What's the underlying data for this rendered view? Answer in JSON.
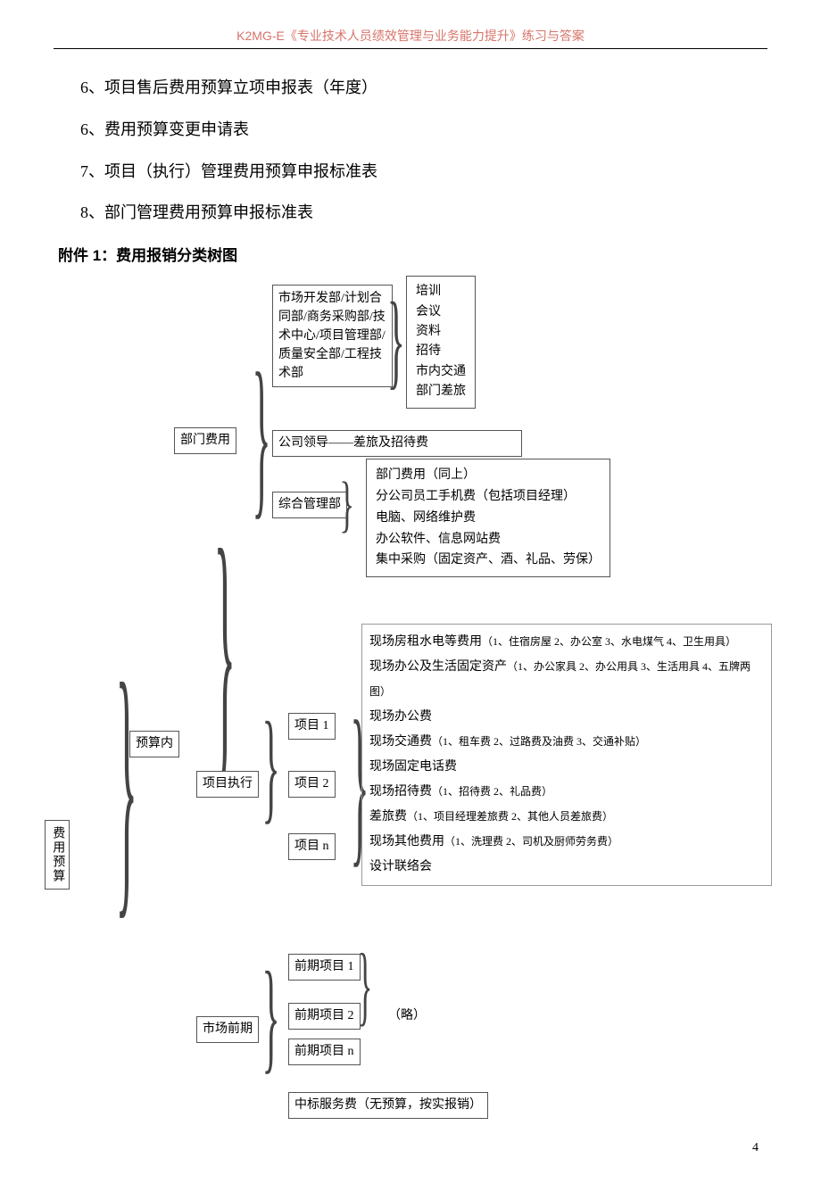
{
  "header": {
    "title": "K2MG-E《专业技术人员绩效管理与业务能力提升》练习与答案"
  },
  "list": {
    "i1": "6、项目售后费用预算立项申报表（年度）",
    "i2": "6、费用预算变更申请表",
    "i3": "7、项目（执行）管理费用预算申报标准表",
    "i4": "8、部门管理费用预算申报标准表"
  },
  "attach": {
    "title": "附件 1：费用报销分类树图"
  },
  "tree": {
    "root": "费用预算",
    "inbudget": "预算内",
    "deptcost": "部门费用",
    "projexec": "项目执行",
    "preproj": "市场前期",
    "depts": "市场开发部/计划合同部/商务采购部/技术中心/项目管理部/质量安全部/工程技术部",
    "dept_items": {
      "a": "培训",
      "b": "会议",
      "c": "资料",
      "d": "招待",
      "e": "市内交通",
      "f": "部门差旅"
    },
    "leader": "公司领导——差旅及招待费",
    "genmgt": "综合管理部",
    "genmgt_items": {
      "a": "部门费用（同上）",
      "b": "分公司员工手机费（包括项目经理）",
      "c": "电脑、网络维护费",
      "d": "办公软件、信息网站费",
      "e": "集中采购（固定资产、酒、礼品、劳保）"
    },
    "proj1": "项目 1",
    "proj2": "项目 2",
    "projn": "项目 n",
    "proj_details": {
      "l1a": "现场房租水电等费用",
      "l1b": "（1、住宿房屋 2、办公室 3、水电煤气 4、卫生用具）",
      "l2a": "现场办公及生活固定资产",
      "l2b": "（1、办公家具 2、办公用具 3、生活用具 4、五牌两图）",
      "l3": "现场办公费",
      "l4a": "现场交通费",
      "l4b": "（1、租车费 2、过路费及油费 3、交通补贴）",
      "l5": "现场固定电话费",
      "l6a": "现场招待费",
      "l6b": "（1、招待费 2、礼品费）",
      "l7a": "差旅费",
      "l7b": "（1、项目经理差旅费 2、其他人员差旅费）",
      "l8a": "现场其他费用",
      "l8b": "（1、洗理费 2、司机及厨师劳务费）",
      "l9": "设计联络会"
    },
    "pre1": "前期项目 1",
    "pre2": "前期项目 2",
    "pren": "前期项目 n",
    "pre_note": "（略）",
    "bidfee": "中标服务费（无预算，按实报销）"
  },
  "page": "4"
}
